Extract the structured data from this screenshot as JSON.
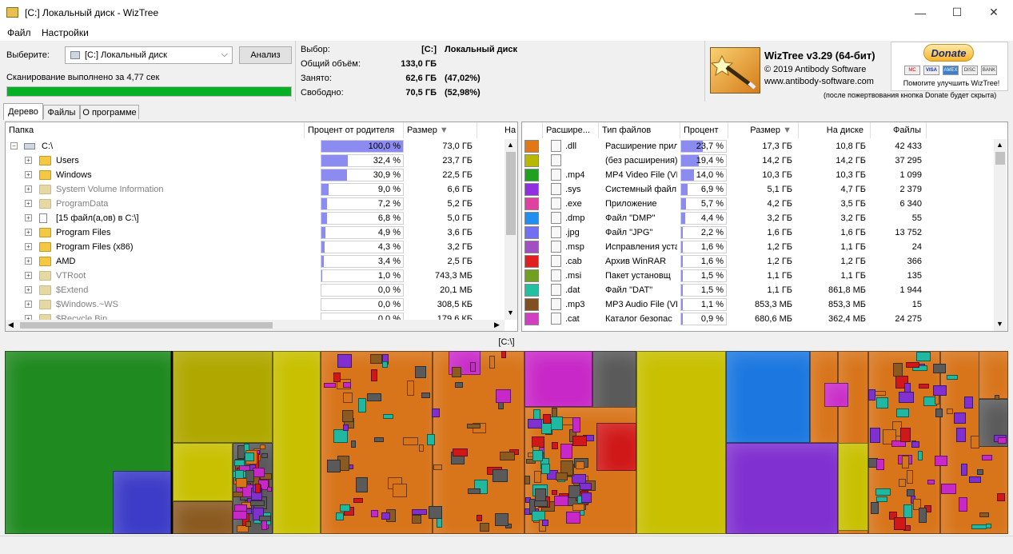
{
  "window": {
    "title": "[C:] Локальный диск  - WizTree",
    "controls": {
      "minimize": "—",
      "maximize": "☐",
      "close": "✕"
    }
  },
  "menu": [
    "Файл",
    "Настройки"
  ],
  "scan": {
    "select_label": "Выберите:",
    "drive_value": "[C:] Локальный диск",
    "analyze_label": "Анализ",
    "status": "Сканирование выполнено за 4,77 сек",
    "progress": 1.0
  },
  "info": {
    "selection_label": "Выбор:",
    "selection_drive": "[C:]",
    "selection_name": "Локальный диск",
    "total_label": "Общий объём:",
    "total_value": "133,0 ГБ",
    "used_label": "Занято:",
    "used_value": "62,6 ГБ",
    "used_pct": "(47,02%)",
    "free_label": "Свободно:",
    "free_value": "70,5 ГБ",
    "free_pct": "(52,98%)"
  },
  "brand": {
    "title": "WizTree v3.29 (64-бит)",
    "copyright": "© 2019 Antibody Software",
    "url": "www.antibody-software.com",
    "donate_label": "Donate",
    "cards": [
      "MC",
      "VISA",
      "AMEX",
      "DISC",
      "BANK"
    ],
    "donate_caption": "Помогите улучшить WizTree!",
    "donate_note": "(после пожертвования кнопка Donate будет скрыта)"
  },
  "tabs": [
    "Дерево",
    "Файлы",
    "О программе"
  ],
  "tree": {
    "columns": [
      "Папка",
      "Процент от родителя",
      "Размер",
      "На"
    ],
    "rows": [
      {
        "name": "C:\\",
        "pct": "100,0 %",
        "pct_val": 100.0,
        "size": "73,0 ГБ",
        "type": "drive",
        "indent": 0
      },
      {
        "name": "Users",
        "pct": "32,4 %",
        "pct_val": 32.4,
        "size": "23,7 ГБ",
        "type": "folder",
        "indent": 1
      },
      {
        "name": "Windows",
        "pct": "30,9 %",
        "pct_val": 30.9,
        "size": "22,5 ГБ",
        "type": "folder",
        "indent": 1
      },
      {
        "name": "System Volume Information",
        "pct": "9,0 %",
        "pct_val": 9.0,
        "size": "6,6 ГБ",
        "type": "sysfolder",
        "indent": 1
      },
      {
        "name": "ProgramData",
        "pct": "7,2 %",
        "pct_val": 7.2,
        "size": "5,2 ГБ",
        "type": "greyfolder",
        "indent": 1
      },
      {
        "name": "[15 файл(а,ов) в C:\\]",
        "pct": "6,8 %",
        "pct_val": 6.8,
        "size": "5,0 ГБ",
        "type": "files",
        "indent": 1
      },
      {
        "name": "Program Files",
        "pct": "4,9 %",
        "pct_val": 4.9,
        "size": "3,6 ГБ",
        "type": "folder",
        "indent": 1
      },
      {
        "name": "Program Files (x86)",
        "pct": "4,3 %",
        "pct_val": 4.3,
        "size": "3,2 ГБ",
        "type": "folder",
        "indent": 1
      },
      {
        "name": "AMD",
        "pct": "3,4 %",
        "pct_val": 3.4,
        "size": "2,5 ГБ",
        "type": "folder",
        "indent": 1
      },
      {
        "name": "VTRoot",
        "pct": "1,0 %",
        "pct_val": 1.0,
        "size": "743,3 МБ",
        "type": "greyfolder",
        "indent": 1
      },
      {
        "name": "$Extend",
        "pct": "0,0 %",
        "pct_val": 0.0,
        "size": "20,1 МБ",
        "type": "sysfolder",
        "indent": 1
      },
      {
        "name": "$Windows.~WS",
        "pct": "0,0 %",
        "pct_val": 0.0,
        "size": "308,5 КБ",
        "type": "greyfolder",
        "indent": 1
      },
      {
        "name": "$Recycle.Bin",
        "pct": "0,0 %",
        "pct_val": 0.0,
        "size": "179,6 КБ",
        "type": "greyfolder",
        "indent": 1
      }
    ]
  },
  "extensions": {
    "columns": [
      "Расшире...",
      "Тип файлов",
      "Процент",
      "Размер",
      "На диске",
      "Файлы"
    ],
    "rows": [
      {
        "color": "#e07818",
        "ext": ".dll",
        "type": "Расширение прил",
        "pct": "23,7 %",
        "pct_val": 23.7,
        "size": "17,3 ГБ",
        "disk": "10,8 ГБ",
        "files": "42 433"
      },
      {
        "color": "#b8b800",
        "ext": "",
        "type": "(без расширения)",
        "pct": "19,4 %",
        "pct_val": 19.4,
        "size": "14,2 ГБ",
        "disk": "14,2 ГБ",
        "files": "37 295"
      },
      {
        "color": "#20a020",
        "ext": ".mp4",
        "type": "MP4 Video File (VL",
        "pct": "14,0 %",
        "pct_val": 14.0,
        "size": "10,3 ГБ",
        "disk": "10,3 ГБ",
        "files": "1 099"
      },
      {
        "color": "#9030e0",
        "ext": ".sys",
        "type": "Системный файл",
        "pct": "6,9 %",
        "pct_val": 6.9,
        "size": "5,1 ГБ",
        "disk": "4,7 ГБ",
        "files": "2 379"
      },
      {
        "color": "#e040a0",
        "ext": ".exe",
        "type": "Приложение",
        "pct": "5,7 %",
        "pct_val": 5.7,
        "size": "4,2 ГБ",
        "disk": "3,5 ГБ",
        "files": "6 340"
      },
      {
        "color": "#2090f0",
        "ext": ".dmp",
        "type": "Файл \"DMP\"",
        "pct": "4,4 %",
        "pct_val": 4.4,
        "size": "3,2 ГБ",
        "disk": "3,2 ГБ",
        "files": "55"
      },
      {
        "color": "#7070f0",
        "ext": ".jpg",
        "type": "Файл \"JPG\"",
        "pct": "2,2 %",
        "pct_val": 2.2,
        "size": "1,6 ГБ",
        "disk": "1,6 ГБ",
        "files": "13 752"
      },
      {
        "color": "#a050c0",
        "ext": ".msp",
        "type": "Исправления уста",
        "pct": "1,6 %",
        "pct_val": 1.6,
        "size": "1,2 ГБ",
        "disk": "1,1 ГБ",
        "files": "24"
      },
      {
        "color": "#e02020",
        "ext": ".cab",
        "type": "Архив WinRAR",
        "pct": "1,6 %",
        "pct_val": 1.6,
        "size": "1,2 ГБ",
        "disk": "1,2 ГБ",
        "files": "366"
      },
      {
        "color": "#70a020",
        "ext": ".msi",
        "type": "Пакет установщ",
        "pct": "1,5 %",
        "pct_val": 1.5,
        "size": "1,1 ГБ",
        "disk": "1,1 ГБ",
        "files": "135"
      },
      {
        "color": "#20c0a0",
        "ext": ".dat",
        "type": "Файл \"DAT\"",
        "pct": "1,5 %",
        "pct_val": 1.5,
        "size": "1,1 ГБ",
        "disk": "861,8 МБ",
        "files": "1 944"
      },
      {
        "color": "#805020",
        "ext": ".mp3",
        "type": "MP3 Audio File (VL",
        "pct": "1,1 %",
        "pct_val": 1.1,
        "size": "853,3 МБ",
        "disk": "853,3 МБ",
        "files": "15"
      },
      {
        "color": "#d040c0",
        "ext": ".cat",
        "type": "Каталог безопас",
        "pct": "0,9 %",
        "pct_val": 0.9,
        "size": "680,6 МБ",
        "disk": "362,4 МБ",
        "files": "24 275"
      }
    ]
  },
  "treemap": {
    "label": "[C:\\]",
    "colors": {
      "green": "#1f8a1f",
      "blue": "#3c3cc8",
      "olive": "#b0a800",
      "yellow": "#c8c000",
      "orange": "#d8741a",
      "grey": "#5a5a5a",
      "magenta": "#c828c8",
      "red": "#d01818",
      "skyblue": "#1c78e0",
      "purple": "#8030d0",
      "teal": "#20b8a0",
      "brown": "#8a5a20"
    }
  }
}
